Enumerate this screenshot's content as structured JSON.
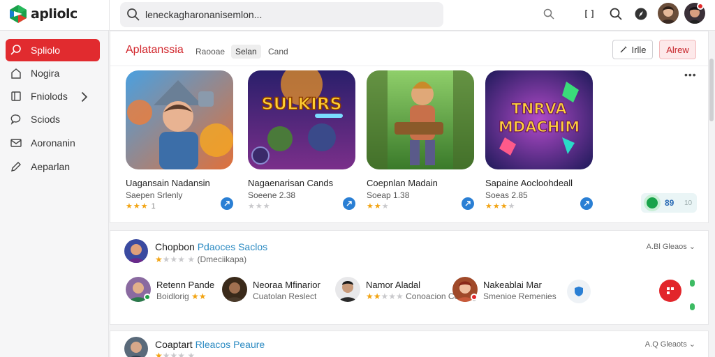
{
  "app": {
    "name": "apliolc"
  },
  "search": {
    "placeholder": "leneckagharonanisemlon..."
  },
  "sidebar": {
    "items": [
      {
        "label": "Spliolo",
        "icon": "search-icon",
        "active": true
      },
      {
        "label": "Nogira",
        "icon": "home-icon"
      },
      {
        "label": "Fniolods",
        "icon": "folder-icon",
        "has_chevron": true
      },
      {
        "label": "Sciods",
        "icon": "chat-icon"
      },
      {
        "label": "Aoronanin",
        "icon": "mail-icon"
      },
      {
        "label": "Aeparlan",
        "icon": "pen-icon"
      }
    ]
  },
  "panel1": {
    "title": "Aplatanssia",
    "chips": [
      "Raooae",
      "Selan",
      "Cand"
    ],
    "filter_button": "Irlle",
    "new_button": "Alrew",
    "more": "•••",
    "cards": [
      {
        "name": "Uagansain Nadansin",
        "sub": "Saepen Srlenly",
        "stars_on": 3,
        "stars_off": 0,
        "rating_text": "1",
        "thumb": "hero-warrior"
      },
      {
        "name": "Nagaenarisan Cands",
        "sub": "Soeene 2.38",
        "stars_on": 0,
        "stars_off": 3,
        "rating_text": "",
        "thumb": "sulkirs"
      },
      {
        "name": "Coepnlan Madain",
        "sub": "Soeap 1.38",
        "stars_on": 2,
        "stars_off": 1,
        "rating_text": "",
        "thumb": "jungle-fighter"
      },
      {
        "name": "Sapaine Aocloohdeall",
        "sub": "Soeas 2.85",
        "stars_on": 3,
        "stars_off": 1,
        "rating_text": "",
        "thumb": "tnrva-mdachim"
      }
    ],
    "thumb_text": {
      "sulkirs": "SULKIRS",
      "tnrva_line1": "TNRVA",
      "tnrva_line2": "MDACHIM"
    },
    "toggle": {
      "label": "89",
      "aux": "10"
    }
  },
  "panel2": {
    "title_main": "Chopbon",
    "title_accent": "Pdaoces Saclos",
    "sub": "(Dmeciikapa)",
    "right": "A.Bl Gleaos",
    "people": [
      {
        "name": "Retenn Pande",
        "sub": "Boidlorig"
      },
      {
        "name": "Neoraa Mfinarior",
        "sub": "Cuatolan Reslect"
      },
      {
        "name": "Namor Aladal",
        "sub": "Conoacion Coaleig"
      },
      {
        "name": "Nakeablai Mar",
        "sub": "Smenioe Remenies"
      }
    ]
  },
  "panel3": {
    "title_main": "Coaptart",
    "title_accent": "Rleacos Peaure",
    "right": "A.Q Gleaots"
  },
  "colors": {
    "accent_red": "#e12b2f",
    "star": "#f2a413",
    "blue": "#2a7fd4",
    "green": "#19a34a"
  }
}
